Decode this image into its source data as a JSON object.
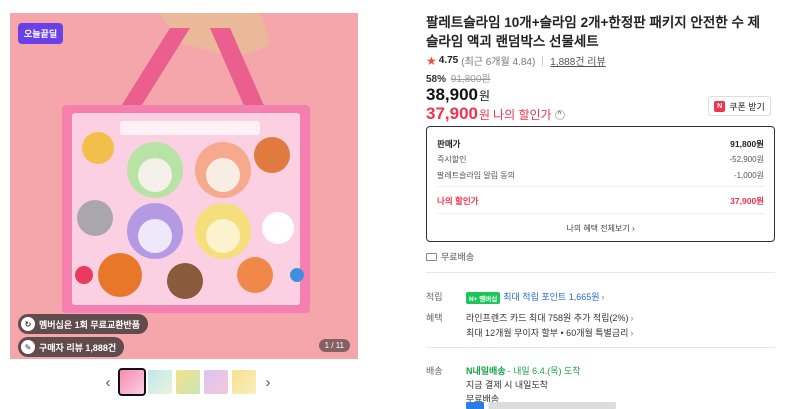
{
  "gallery": {
    "badge": "오늘끝딜",
    "pill_membership": "멤버십은 1회 무료교환반품",
    "pill_reviews": "구매자 리뷰 1,888건",
    "page_counter": "1 / 11",
    "prev_icon": "chevron-left-icon",
    "next_icon": "chevron-right-icon"
  },
  "product": {
    "title": "팔레트슬라임 10개+슬라임 2개+한정판 패키지 안전한 수 제 슬라임 액괴 랜덤박스 선물세트",
    "rating_score": "4.75",
    "rating_recent": "(최근 6개월 4.84)",
    "review_link": "1,888건 리뷰",
    "discount_rate": "58%",
    "original_price": "91,800원",
    "sale_price": "38,900",
    "my_price": "37,900",
    "won": "원",
    "my_price_label": "나의 할인가",
    "coupon_button": "쿠폰 받기",
    "coupon_badge": "N"
  },
  "breakdown": {
    "rows": [
      {
        "label": "판매가",
        "value": "91,800원"
      },
      {
        "label": "즉시할인",
        "value": "-52,900원"
      },
      {
        "label": "팔레트슬라임 알림 동의",
        "value": "-1,000원"
      },
      {
        "label": "나의 할인가",
        "value": "37,900원"
      }
    ],
    "more_link": "나의 혜택 전체보기"
  },
  "shipping": {
    "free": "무료배송"
  },
  "benefits": {
    "points_label": "적립",
    "points_badge": "N+ 멤버십",
    "points_text": "최대 적립 포인트 1,665원",
    "benefit_label": "혜택",
    "card_text": "라인프렌즈 카드 최대 758원 추가 적립(2%)",
    "installment_text": "최대 12개월 무이자 할부 • 60개월 특별금리",
    "delivery_label": "배송",
    "arrive_badge": "N내일배송",
    "arrive_text": "- 내일 6.4.(목) 도착",
    "pay_now_text": "지금 결제 시 내일도착",
    "free_text": "무료배송"
  },
  "colors": {
    "accent_red": "#f0344c",
    "points_blue": "#2468e0",
    "naver_green": "#1bc55a",
    "badge_purple": "#6a40e8"
  }
}
